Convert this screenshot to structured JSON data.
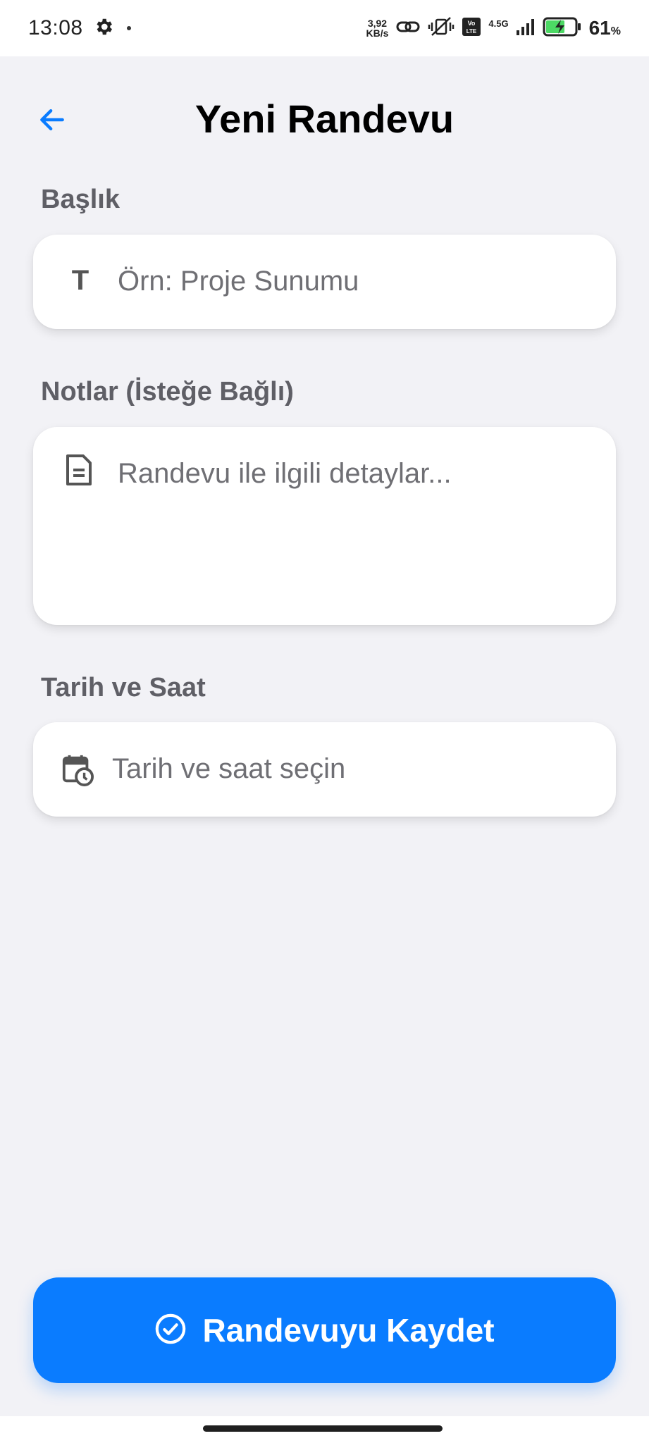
{
  "status_bar": {
    "time": "13:08",
    "net_speed_value": "3,92",
    "net_speed_unit": "KB/s",
    "network_type": "4.5G",
    "battery_percent": "61",
    "battery_unit": "%"
  },
  "header": {
    "title": "Yeni Randevu"
  },
  "form": {
    "title_label": "Başlık",
    "title_placeholder": "Örn: Proje Sunumu",
    "title_icon": "T",
    "notes_label": "Notlar (İsteğe Bağlı)",
    "notes_placeholder": "Randevu ile ilgili detaylar...",
    "datetime_label": "Tarih ve Saat",
    "datetime_placeholder": "Tarih ve saat seçin"
  },
  "actions": {
    "save_label": "Randevuyu Kaydet"
  },
  "colors": {
    "accent": "#0a7cff",
    "background": "#f2f2f6",
    "label": "#5f5f66",
    "placeholder": "#6f6f74"
  },
  "icons": {
    "back": "arrow-left-icon",
    "title_field": "text-t-icon",
    "notes_field": "document-icon",
    "datetime_field": "calendar-clock-icon",
    "save": "check-circle-icon"
  }
}
